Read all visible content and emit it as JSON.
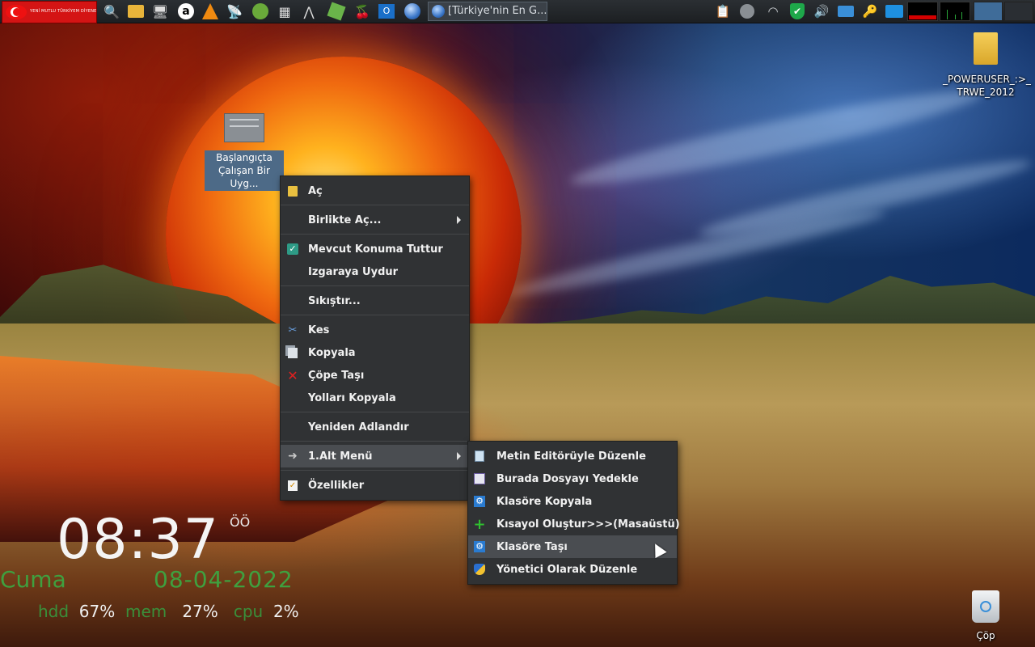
{
  "taskbar": {
    "start_banner": "YENİ MUTLU TÜRKİYEM DİYENE",
    "launchers": [
      "search-icon",
      "file-manager-icon",
      "monitor-icon",
      "amazon-icon",
      "vlc-icon",
      "satellite-icon",
      "keepassx-icon",
      "calculator-icon",
      "arch-icon",
      "notepad-icon",
      "cherry-icon",
      "outlook-icon",
      "browser-globe-icon"
    ],
    "active_window_title": "[Türkiye'nin En G...",
    "tray": [
      "clipboard-icon",
      "chat-icon",
      "wifi-icon",
      "shield-icon",
      "volume-icon",
      "network-icon",
      "key-icon",
      "keyboard-icon"
    ]
  },
  "desktop": {
    "selected_icon_label_line1": "Başlangıçta",
    "selected_icon_label_line2": "Çalışan Bir Uyg...",
    "folder_label_line1": "_POWERUSER_:>_",
    "folder_label_line2": "TRWE_2012",
    "trash_label": "Çöp"
  },
  "context_menu": {
    "items": [
      {
        "label": "Aç",
        "icon": "open-file-icon"
      },
      {
        "label": "Birlikte Aç...",
        "icon": "",
        "submenu": true
      },
      {
        "label": "Mevcut Konuma Tuttur",
        "icon": "checkbox-checked-icon"
      },
      {
        "label": "Izgaraya Uydur",
        "icon": ""
      },
      {
        "label": "Sıkıştır...",
        "icon": ""
      },
      {
        "label": "Kes",
        "icon": "scissors-icon"
      },
      {
        "label": "Kopyala",
        "icon": "copy-icon"
      },
      {
        "label": "Çöpe Taşı",
        "icon": "delete-x-icon"
      },
      {
        "label": "Yolları Kopyala",
        "icon": ""
      },
      {
        "label": "Yeniden Adlandır",
        "icon": ""
      },
      {
        "label": "1.Alt Menü",
        "icon": "arrow-right-icon",
        "submenu": true
      },
      {
        "label": "Özellikler",
        "icon": "properties-icon"
      }
    ]
  },
  "submenu": {
    "items": [
      {
        "label": "Metin Editörüyle Düzenle",
        "icon": "text-editor-icon"
      },
      {
        "label": "Burada Dosyayı Yedekle",
        "icon": "backup-icon"
      },
      {
        "label": "Klasöre Kopyala",
        "icon": "gear-icon"
      },
      {
        "label": "Kısayol Oluştur>>>(Masaüstü)",
        "icon": "plus-icon"
      },
      {
        "label": "Klasöre Taşı",
        "icon": "gear-icon"
      },
      {
        "label": "Yönetici Olarak Düzenle",
        "icon": "admin-shield-icon"
      }
    ],
    "highlighted_index": 4
  },
  "conky": {
    "time": "08:37",
    "ampm": "ÖÖ",
    "day": "Cuma",
    "date": "08-04-2022",
    "hdd_label": "hdd",
    "hdd_value": "67%",
    "mem_label": "mem",
    "mem_value": "27%",
    "cpu_label": "cpu",
    "cpu_value": "2%"
  },
  "colors": {
    "menu_bg": "#303234",
    "menu_highlight": "#4a4d51",
    "conky_green": "#3fa03f",
    "selection_blue": "#4d6a87"
  }
}
